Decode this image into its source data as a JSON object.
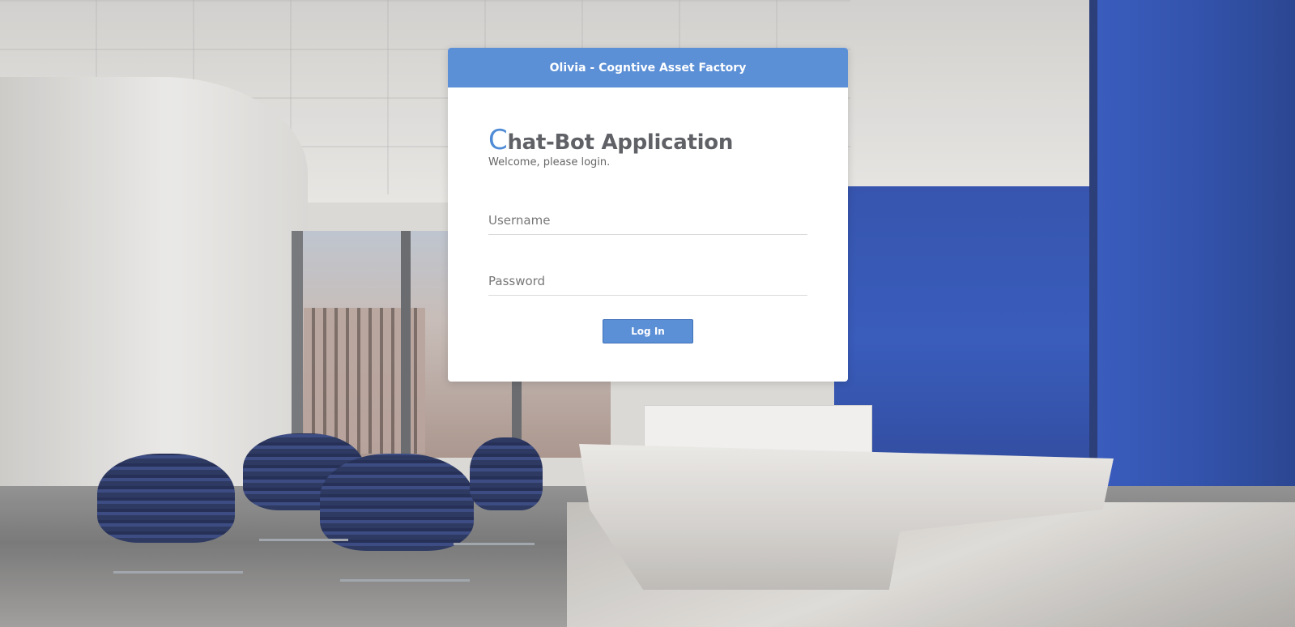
{
  "header": {
    "title": "Olivia - Cogntive Asset Factory"
  },
  "login": {
    "title_first_letter": "C",
    "title_rest": "hat-Bot Application",
    "subtitle": "Welcome, please login.",
    "username_placeholder": "Username",
    "password_placeholder": "Password",
    "login_button": "Log In"
  },
  "colors": {
    "accent": "#5b8fd6",
    "title_letter": "#4f8bd6",
    "title_text": "#5f6166"
  }
}
